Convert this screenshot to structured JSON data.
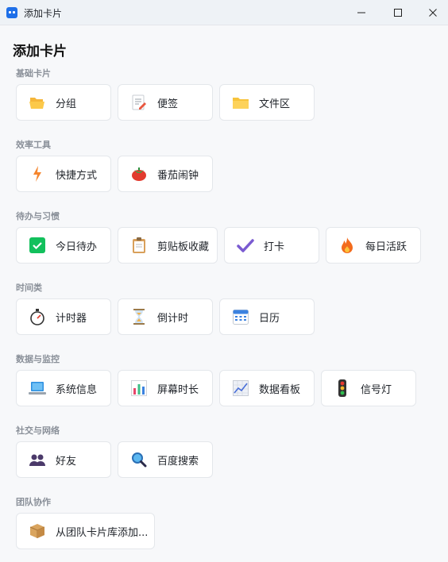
{
  "window": {
    "title": "添加卡片"
  },
  "page": {
    "title": "添加卡片"
  },
  "sections": [
    {
      "label": "基础卡片",
      "cards": [
        {
          "label": "分组",
          "icon": "folder-open-icon"
        },
        {
          "label": "便签",
          "icon": "memo-icon"
        },
        {
          "label": "文件区",
          "icon": "folder-icon"
        }
      ]
    },
    {
      "label": "效率工具",
      "cards": [
        {
          "label": "快捷方式",
          "icon": "lightning-icon"
        },
        {
          "label": "番茄闹钟",
          "icon": "tomato-icon"
        }
      ]
    },
    {
      "label": "待办与习惯",
      "cards": [
        {
          "label": "今日待办",
          "icon": "check-box-icon"
        },
        {
          "label": "剪贴板收藏",
          "icon": "clipboard-icon"
        },
        {
          "label": "打卡",
          "icon": "check-mark-icon"
        },
        {
          "label": "每日活跃",
          "icon": "fire-icon"
        }
      ]
    },
    {
      "label": "时间类",
      "cards": [
        {
          "label": "计时器",
          "icon": "stopwatch-icon"
        },
        {
          "label": "倒计时",
          "icon": "hourglass-icon"
        },
        {
          "label": "日历",
          "icon": "calendar-icon"
        }
      ]
    },
    {
      "label": "数据与监控",
      "cards": [
        {
          "label": "系统信息",
          "icon": "laptop-icon"
        },
        {
          "label": "屏幕时长",
          "icon": "bar-chart-icon"
        },
        {
          "label": "数据看板",
          "icon": "line-chart-icon"
        },
        {
          "label": "信号灯",
          "icon": "traffic-light-icon"
        }
      ]
    },
    {
      "label": "社交与网络",
      "cards": [
        {
          "label": "好友",
          "icon": "people-icon"
        },
        {
          "label": "百度搜索",
          "icon": "magnifier-icon"
        }
      ]
    },
    {
      "label": "团队协作",
      "cards": [
        {
          "label": "从团队卡片库添加...",
          "icon": "package-icon"
        }
      ]
    }
  ]
}
